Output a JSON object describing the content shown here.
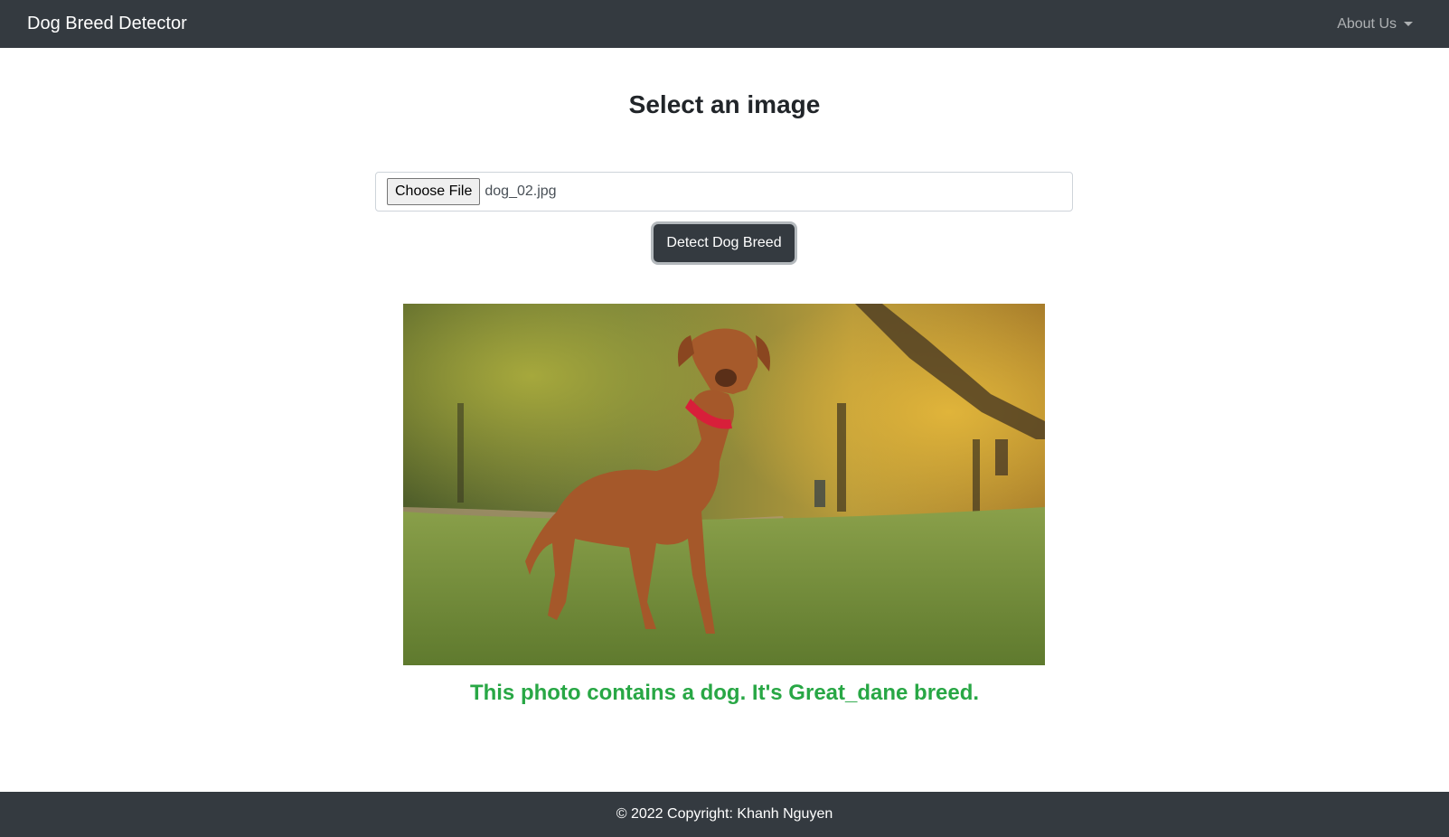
{
  "navbar": {
    "brand": "Dog Breed Detector",
    "about_label": "About Us"
  },
  "main": {
    "title": "Select an image",
    "file_input": {
      "button_label": "Choose File",
      "file_name": "dog_02.jpg"
    },
    "detect_button_label": "Detect Dog Breed",
    "result_text": "This photo contains a dog. It's Great_dane breed."
  },
  "footer": {
    "copyright": "© 2022 Copyright: Khanh Nguyen"
  },
  "colors": {
    "navbar_bg": "#343a40",
    "result_green": "#28a745"
  },
  "icons": {
    "about_dropdown": "caret-down-icon"
  }
}
